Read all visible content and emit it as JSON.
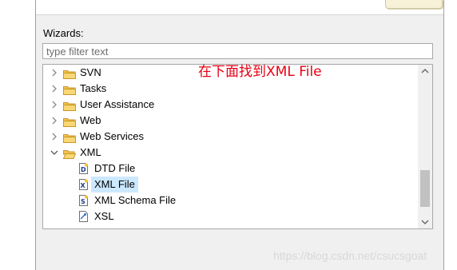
{
  "wizards_label": "Wizards:",
  "filter": {
    "placeholder": "type filter text",
    "value": ""
  },
  "annotation": "在下面找到XML File",
  "watermark": "https://blog.csdn.net/csucsgoat",
  "tree": [
    {
      "label": "SVN",
      "expanded": false,
      "icon": "folder-icon"
    },
    {
      "label": "Tasks",
      "expanded": false,
      "icon": "folder-icon"
    },
    {
      "label": "User Assistance",
      "expanded": false,
      "icon": "folder-icon"
    },
    {
      "label": "Web",
      "expanded": false,
      "icon": "folder-icon"
    },
    {
      "label": "Web Services",
      "expanded": false,
      "icon": "folder-icon"
    },
    {
      "label": "XML",
      "expanded": true,
      "icon": "folder-open-icon",
      "children": [
        {
          "label": "DTD File",
          "icon": "dtd-file-icon"
        },
        {
          "label": "XML File",
          "icon": "xml-file-icon",
          "selected": true
        },
        {
          "label": "XML Schema File",
          "icon": "xsd-file-icon"
        },
        {
          "label": "XSL",
          "icon": "xsl-file-icon"
        }
      ]
    }
  ],
  "colors": {
    "selection": "#cce8ff",
    "annotation": "#e60012",
    "folder": "#f4c24f"
  }
}
